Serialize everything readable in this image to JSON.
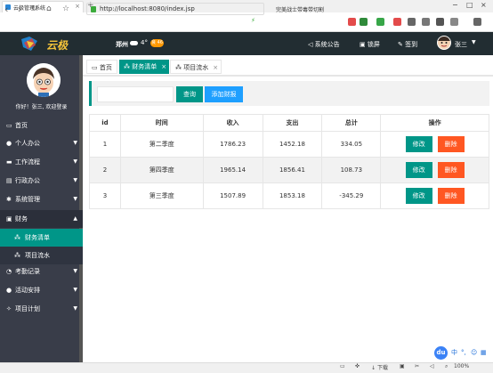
{
  "browser": {
    "tab_title": "云极管理系统",
    "url": "http://localhost:8080/index.jsp",
    "news": "完美战士带毒带切割"
  },
  "header": {
    "logo_text": "云极",
    "city": "郑州",
    "temp": "4°",
    "aqi": "良 46",
    "announcement": "系统公告",
    "lock": "锁屏",
    "signin": "签到",
    "user": "张三"
  },
  "sidebar": {
    "welcome": "你好！张三, 欢迎登录",
    "items": [
      {
        "label": "首页",
        "icon": "monitor-icon"
      },
      {
        "label": "个人办公",
        "icon": "user-icon"
      },
      {
        "label": "工作流程",
        "icon": "folder-icon"
      },
      {
        "label": "行政办公",
        "icon": "admin-icon"
      },
      {
        "label": "系统管理",
        "icon": "wrench-icon"
      },
      {
        "label": "财务",
        "icon": "finance-icon"
      },
      {
        "label": "财务清单",
        "icon": "list-icon"
      },
      {
        "label": "项目流水",
        "icon": "list-icon"
      },
      {
        "label": "考勤记录",
        "icon": "clock-icon"
      },
      {
        "label": "活动安排",
        "icon": "dot-icon"
      },
      {
        "label": "项目计划",
        "icon": "spark-icon"
      }
    ]
  },
  "content_tabs": {
    "home": "首页",
    "finance": "财务清单",
    "project": "项目流水"
  },
  "search": {
    "placeholder": "",
    "query_label": "查询",
    "add_label": "添加财报"
  },
  "table": {
    "headers": [
      "id",
      "时间",
      "收入",
      "支出",
      "总计",
      "操作"
    ],
    "rows": [
      {
        "id": "1",
        "time": "第二季度",
        "income": "1786.23",
        "expense": "1452.18",
        "total": "334.05"
      },
      {
        "id": "2",
        "time": "第四季度",
        "income": "1965.14",
        "expense": "1856.41",
        "total": "108.73"
      },
      {
        "id": "3",
        "time": "第三季度",
        "income": "1507.89",
        "expense": "1853.18",
        "total": "-345.29"
      }
    ],
    "edit_label": "修改",
    "delete_label": "删除"
  },
  "statusbar": {
    "download": "下载",
    "zoom": "100%"
  },
  "baidu": {
    "badge": "du",
    "lang": "中"
  }
}
